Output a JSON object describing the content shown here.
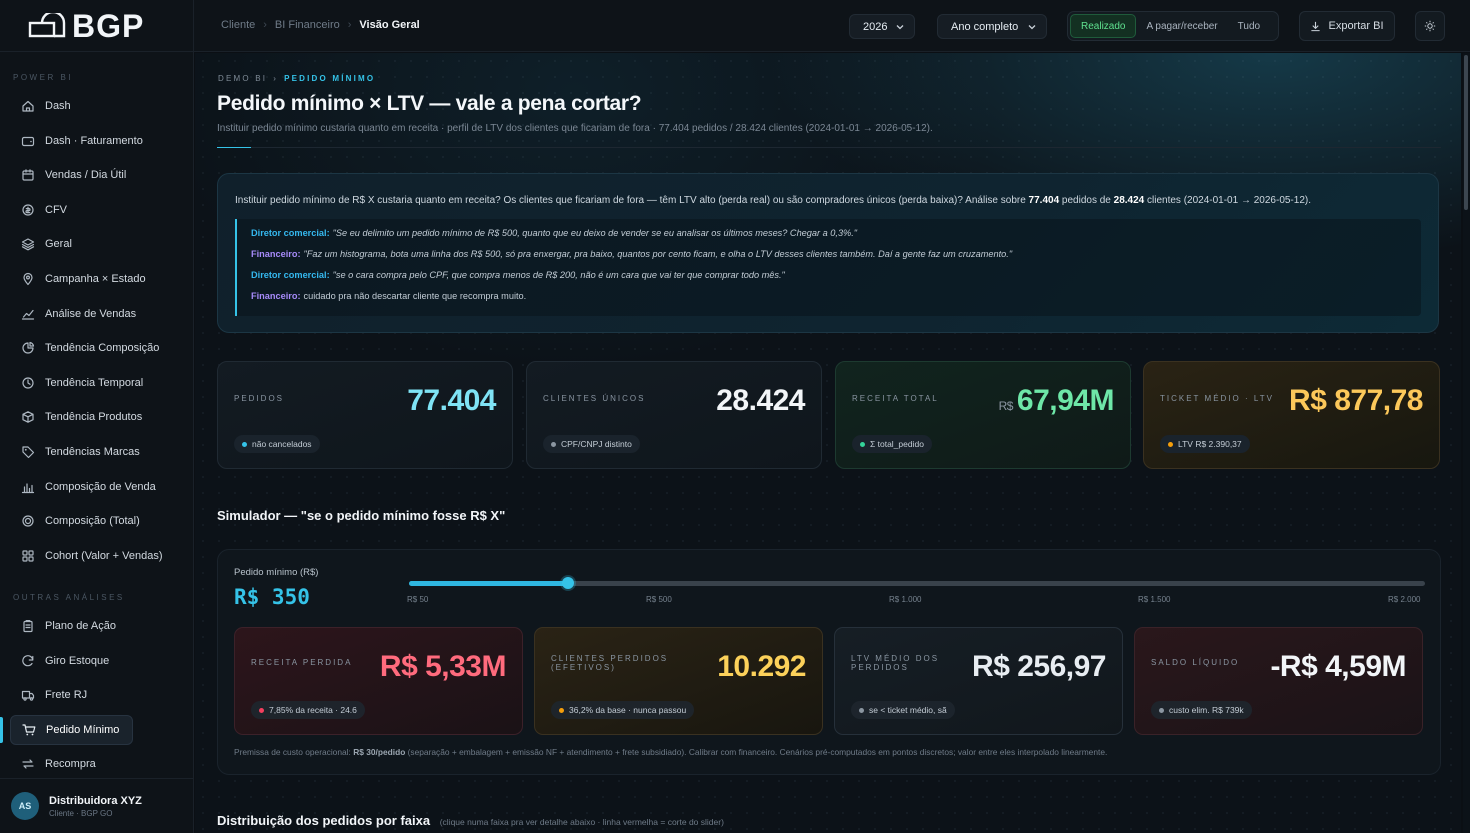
{
  "brand": {
    "logo_text": "BGP"
  },
  "sidebar": {
    "section_main": "POWER BI",
    "items": [
      {
        "label": "Dash",
        "icon": "home-icon"
      },
      {
        "label": "Dash · Faturamento",
        "icon": "wallet-icon"
      },
      {
        "label": "Vendas / Dia Útil",
        "icon": "calendar-icon"
      },
      {
        "label": "CFV",
        "icon": "coin-icon"
      },
      {
        "label": "Geral",
        "icon": "layers-icon"
      },
      {
        "label": "Campanha × Estado",
        "icon": "map-pin-icon"
      },
      {
        "label": "Análise de Vendas",
        "icon": "line-chart-icon"
      },
      {
        "label": "Tendência Composição",
        "icon": "pie-chart-icon"
      },
      {
        "label": "Tendência Temporal",
        "icon": "clock-icon"
      },
      {
        "label": "Tendência Produtos",
        "icon": "box-icon"
      },
      {
        "label": "Tendências Marcas",
        "icon": "tag-icon"
      },
      {
        "label": "Composição de Venda",
        "icon": "bar-chart-icon"
      },
      {
        "label": "Composição (Total)",
        "icon": "target-icon"
      },
      {
        "label": "Cohort (Valor + Vendas)",
        "icon": "grid-icon"
      }
    ],
    "section_other": "OUTRAS ANÁLISES",
    "other_items": [
      {
        "label": "Plano de Ação",
        "icon": "clipboard-icon"
      },
      {
        "label": "Giro Estoque",
        "icon": "refresh-icon"
      },
      {
        "label": "Frete RJ",
        "icon": "truck-icon"
      },
      {
        "label": "Pedido Mínimo",
        "icon": "cart-icon"
      },
      {
        "label": "Recompra",
        "icon": "repeat-icon"
      }
    ],
    "user": {
      "initials": "AS",
      "name": "Distribuidora XYZ",
      "subtitle": "Cliente · BGP GO"
    }
  },
  "topbar": {
    "breadcrumb": [
      "Cliente",
      "BI Financeiro",
      "Visão Geral"
    ],
    "year": "2026",
    "period": "Ano completo",
    "segments": [
      "Realizado",
      "A pagar/receber",
      "Tudo"
    ],
    "active_segment": "Realizado",
    "export_label": "Exportar BI"
  },
  "page": {
    "eyebrow": [
      "DEMO BI",
      "PEDIDO MÍNIMO"
    ],
    "title": "Pedido mínimo × LTV — vale a pena cortar?",
    "subtitle": "Instituir pedido mínimo custaria quanto em receita · perfil de LTV dos clientes que ficariam de fora · 77.404 pedidos / 28.424 clientes (2024-01-01 → 2026-05-12)."
  },
  "brief": {
    "text_a": "Instituir pedido mínimo de R$ X custaria quanto em receita? Os clientes que ficariam de fora — têm LTV alto (perda real) ou são compradores únicos (perda baixa)? Análise sobre ",
    "pedidos": "77.404",
    "text_b": " pedidos de ",
    "clientes": "28.424",
    "text_c": " clientes (2024-01-01 → 2026-05-12).",
    "quotes": [
      {
        "who": "Diretor comercial:",
        "role": "dc",
        "text": "\"Se eu delimito um pedido mínimo de R$ 500, quanto que eu deixo de vender se eu analisar os últimos meses? Chegar a 0,3%.\"",
        "italic": true
      },
      {
        "who": "Financeiro:",
        "role": "fi",
        "text": "\"Faz um histograma, bota uma linha dos R$ 500, só pra enxergar, pra baixo, quantos por cento ficam, e olha o LTV desses clientes também. Daí a gente faz um cruzamento.\"",
        "italic": true
      },
      {
        "who": "Diretor comercial:",
        "role": "dc",
        "text": "\"se o cara compra pelo CPF, que compra menos de R$ 200, não é um cara que vai ter que comprar todo mês.\"",
        "italic": true
      },
      {
        "who": "Financeiro:",
        "role": "fi",
        "text": "cuidado pra não descartar cliente que recompra muito.",
        "italic": false
      }
    ]
  },
  "kpis": [
    {
      "label": "PEDIDOS",
      "prefix": "",
      "value": "77.404",
      "chip": "não cancelados",
      "color": "#7fe3f5",
      "dot": "#35c3e8"
    },
    {
      "label": "CLIENTES ÚNICOS",
      "prefix": "",
      "value": "28.424",
      "chip": "CPF/CNPJ distinto",
      "color": "#f2f5f8",
      "dot": "#8b96a1"
    },
    {
      "label": "RECEITA TOTAL",
      "prefix": "R$",
      "value": "67,94M",
      "chip": "Σ total_pedido",
      "color": "#6ee7a8",
      "dot": "#34d399"
    },
    {
      "label": "TICKET MÉDIO · LTV",
      "prefix": "",
      "value": "R$ 877,78",
      "chip": "LTV R$ 2.390,37",
      "color": "#fcc85a",
      "dot": "#f59e0b"
    }
  ],
  "simulator": {
    "title": "Simulador — \"se o pedido mínimo fosse R$ X\"",
    "input_label": "Pedido mínimo (R$)",
    "value_display": "R$ 350",
    "value": 350,
    "min": 50,
    "max": 2000,
    "ticks": [
      "R$ 50",
      "R$ 500",
      "R$ 1.000",
      "R$ 1.500",
      "R$ 2.000"
    ],
    "results": [
      {
        "label": "RECEITA PERDIDA",
        "value": "R$ 5,33M",
        "chip": "7,85% da receita · 24.6",
        "color": "#ff6b7d",
        "dot": "#f43f5e"
      },
      {
        "label": "CLIENTES PERDIDOS (EFETIVOS)",
        "value": "10.292",
        "chip": "36,2% da base · nunca passou",
        "color": "#fcd15a",
        "dot": "#f59e0b"
      },
      {
        "label": "LTV MÉDIO DOS PERDIDOS",
        "value": "R$ 256,97",
        "chip": "se < ticket médio, sã",
        "color": "#e8edf2",
        "dot": "#8b96a1"
      },
      {
        "label": "SALDO LÍQUIDO",
        "value": "-R$ 4,59M",
        "chip": "custo elim. R$ 739k",
        "color": "#f2f5f8",
        "dot": "#8b96a1"
      }
    ],
    "premise_a": "Premissa de custo operacional: ",
    "premise_b": "R$ 30/pedido",
    "premise_c": " (separação + embalagem + emissão NF + atendimento + frete subsidiado). Calibrar com financeiro. Cenários pré-computados em pontos discretos; valor entre eles interpolado linearmente."
  },
  "distribution": {
    "title": "Distribuição dos pedidos por faixa",
    "hint": "(clique numa faixa pra ver detalhe abaixo · linha vermelha = corte do slider)"
  }
}
